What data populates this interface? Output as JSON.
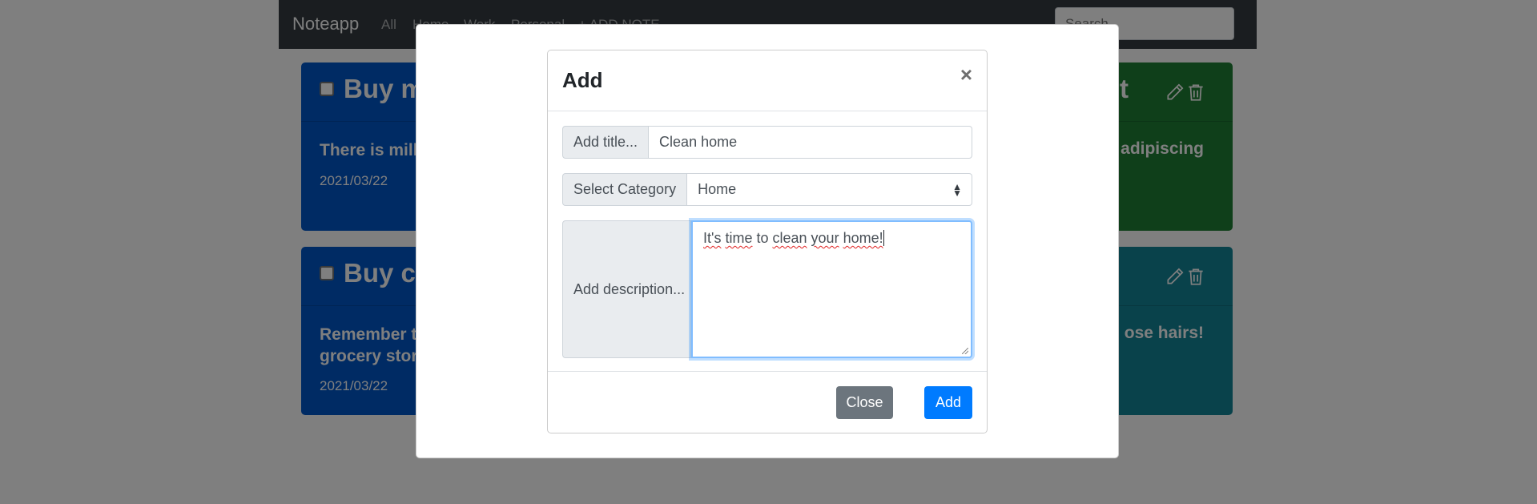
{
  "navbar": {
    "brand": "Noteapp",
    "links": [
      "All",
      "Home",
      "Work",
      "Personal",
      "+ ADD NOTE"
    ],
    "search_placeholder": "Search"
  },
  "notes": [
    {
      "title_left": "Buy m",
      "body_left": "There is milk",
      "date": "2021/03/22",
      "title_right": "t",
      "body_right": "adipiscing",
      "left_color": "#0056c8",
      "right_color": "#1e7e34"
    },
    {
      "title_left": "Buy ch",
      "body_left_line1": "Remember t",
      "body_left_line2": "grocery stor",
      "date": "2021/03/22",
      "body_right": "ose hairs!",
      "left_color": "#0056c8",
      "right_color": "#138496"
    }
  ],
  "modal": {
    "title": "Add",
    "close_symbol": "×",
    "title_addon": "Add title...",
    "title_value": "Clean home",
    "category_addon": "Select Category",
    "category_value": "Home",
    "description_addon": "Add description...",
    "description_value": {
      "w1": "It's",
      "s1": " ",
      "w2": "time",
      "s2": " to ",
      "w3": "clean",
      "s3": " ",
      "w4": "your",
      "s4": " ",
      "w5": "home!"
    },
    "close_button": "Close",
    "add_button": "Add"
  },
  "colors": {
    "primary": "#007bff",
    "secondary": "#6c757d",
    "navbar": "#343a40"
  }
}
